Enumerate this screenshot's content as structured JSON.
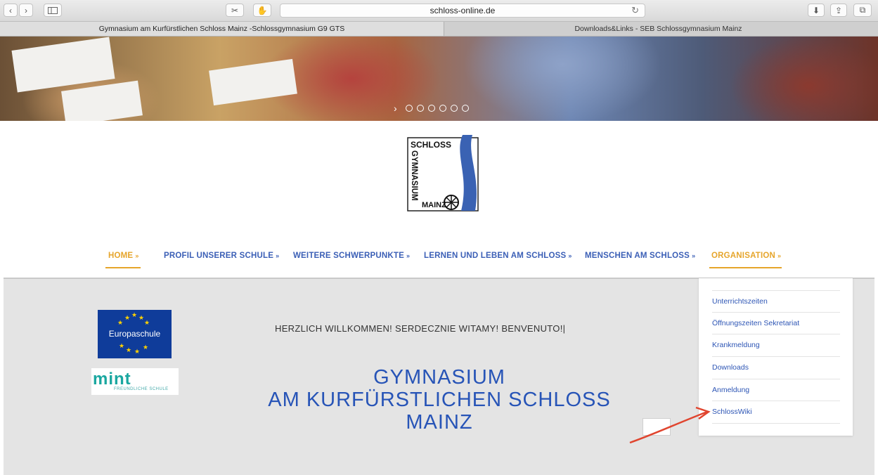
{
  "browser": {
    "url": "schloss-online.de",
    "tabs": [
      {
        "title": "Gymnasium am Kurfürstlichen Schloss Mainz -Schlossgymnasium G9 GTS",
        "active": true
      },
      {
        "title": "Downloads&Links - SEB Schlossgymnasium Mainz",
        "active": false
      }
    ]
  },
  "logo": {
    "line1": "SCHLOSS",
    "line2": "GYMNASIUM",
    "line3": "MAINZ"
  },
  "nav": {
    "items": [
      {
        "label": "HOME",
        "active": true
      },
      {
        "label": "PROFIL UNSERER SCHULE",
        "active": false
      },
      {
        "label": "WEITERE SCHWERPUNKTE",
        "active": false
      },
      {
        "label": "LERNEN UND LEBEN AM SCHLOSS",
        "active": false
      },
      {
        "label": "MENSCHEN AM SCHLOSS",
        "active": false
      },
      {
        "label": "ORGANISATION",
        "active": true
      }
    ],
    "arrow": "»"
  },
  "badges": {
    "europaschule": "Europaschule",
    "mint_big": "mint",
    "mint_small": "FREUNDLICHE SCHULE"
  },
  "main": {
    "welcome": "HERZLICH WILLKOMMEN! SERDECZNIE WITAMY! BENVENUTO!|",
    "title_lines": [
      "GYMNASIUM",
      "AM KURFÜRSTLICHEN SCHLOSS",
      "MAINZ"
    ]
  },
  "dropdown": {
    "items": [
      "Unterrichtszeiten",
      "Öffnungszeiten Sekretariat",
      "Krankmeldung",
      "Downloads",
      "Anmeldung",
      "SchlossWiki"
    ]
  },
  "colors": {
    "nav_blue": "#3b5fb6",
    "nav_active": "#e6a52b",
    "title_blue": "#2754b7",
    "annotation_arrow": "#e0452f"
  }
}
